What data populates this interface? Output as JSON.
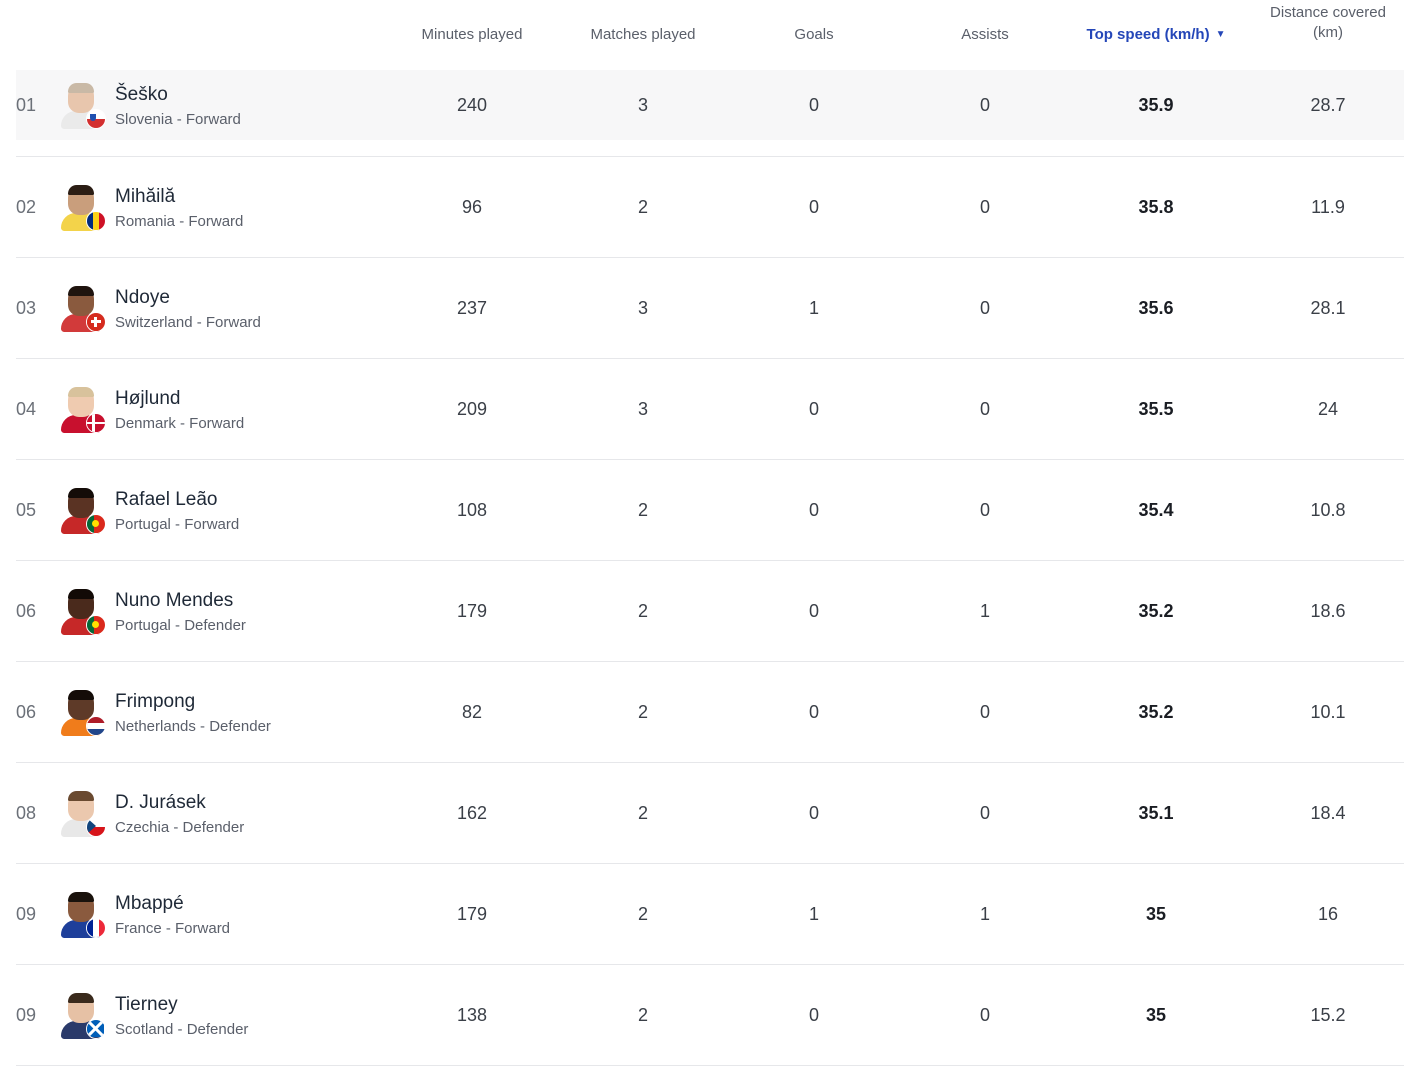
{
  "columns": {
    "minutes": "Minutes played",
    "matches": "Matches played",
    "goals": "Goals",
    "assists": "Assists",
    "top_speed": "Top speed (km/h)",
    "distance_line1": "Distance covered",
    "distance_line2": "(km)"
  },
  "sort_icon": "caret-down-icon",
  "colors": {
    "accent": "#2446b8"
  },
  "players": [
    {
      "rank": "01",
      "name": "Šeško",
      "sub": "Slovenia - Forward",
      "minutes": "240",
      "matches": "3",
      "goals": "0",
      "assists": "0",
      "top_speed": "35.9",
      "distance": "28.7",
      "flag": "slovenia"
    },
    {
      "rank": "02",
      "name": "Mihăilă",
      "sub": "Romania - Forward",
      "minutes": "96",
      "matches": "2",
      "goals": "0",
      "assists": "0",
      "top_speed": "35.8",
      "distance": "11.9",
      "flag": "romania"
    },
    {
      "rank": "03",
      "name": "Ndoye",
      "sub": "Switzerland - Forward",
      "minutes": "237",
      "matches": "3",
      "goals": "1",
      "assists": "0",
      "top_speed": "35.6",
      "distance": "28.1",
      "flag": "switzerland"
    },
    {
      "rank": "04",
      "name": "Højlund",
      "sub": "Denmark - Forward",
      "minutes": "209",
      "matches": "3",
      "goals": "0",
      "assists": "0",
      "top_speed": "35.5",
      "distance": "24",
      "flag": "denmark"
    },
    {
      "rank": "05",
      "name": "Rafael Leão",
      "sub": "Portugal - Forward",
      "minutes": "108",
      "matches": "2",
      "goals": "0",
      "assists": "0",
      "top_speed": "35.4",
      "distance": "10.8",
      "flag": "portugal"
    },
    {
      "rank": "06",
      "name": "Nuno Mendes",
      "sub": "Portugal - Defender",
      "minutes": "179",
      "matches": "2",
      "goals": "0",
      "assists": "1",
      "top_speed": "35.2",
      "distance": "18.6",
      "flag": "portugal"
    },
    {
      "rank": "06",
      "name": "Frimpong",
      "sub": "Netherlands - Defender",
      "minutes": "82",
      "matches": "2",
      "goals": "0",
      "assists": "0",
      "top_speed": "35.2",
      "distance": "10.1",
      "flag": "netherlands"
    },
    {
      "rank": "08",
      "name": "D. Jurásek",
      "sub": "Czechia - Defender",
      "minutes": "162",
      "matches": "2",
      "goals": "0",
      "assists": "0",
      "top_speed": "35.1",
      "distance": "18.4",
      "flag": "czechia"
    },
    {
      "rank": "09",
      "name": "Mbappé",
      "sub": "France - Forward",
      "minutes": "179",
      "matches": "2",
      "goals": "1",
      "assists": "1",
      "top_speed": "35",
      "distance": "16",
      "flag": "france"
    },
    {
      "rank": "09",
      "name": "Tierney",
      "sub": "Scotland - Defender",
      "minutes": "138",
      "matches": "2",
      "goals": "0",
      "assists": "0",
      "top_speed": "35",
      "distance": "15.2",
      "flag": "scotland"
    }
  ]
}
